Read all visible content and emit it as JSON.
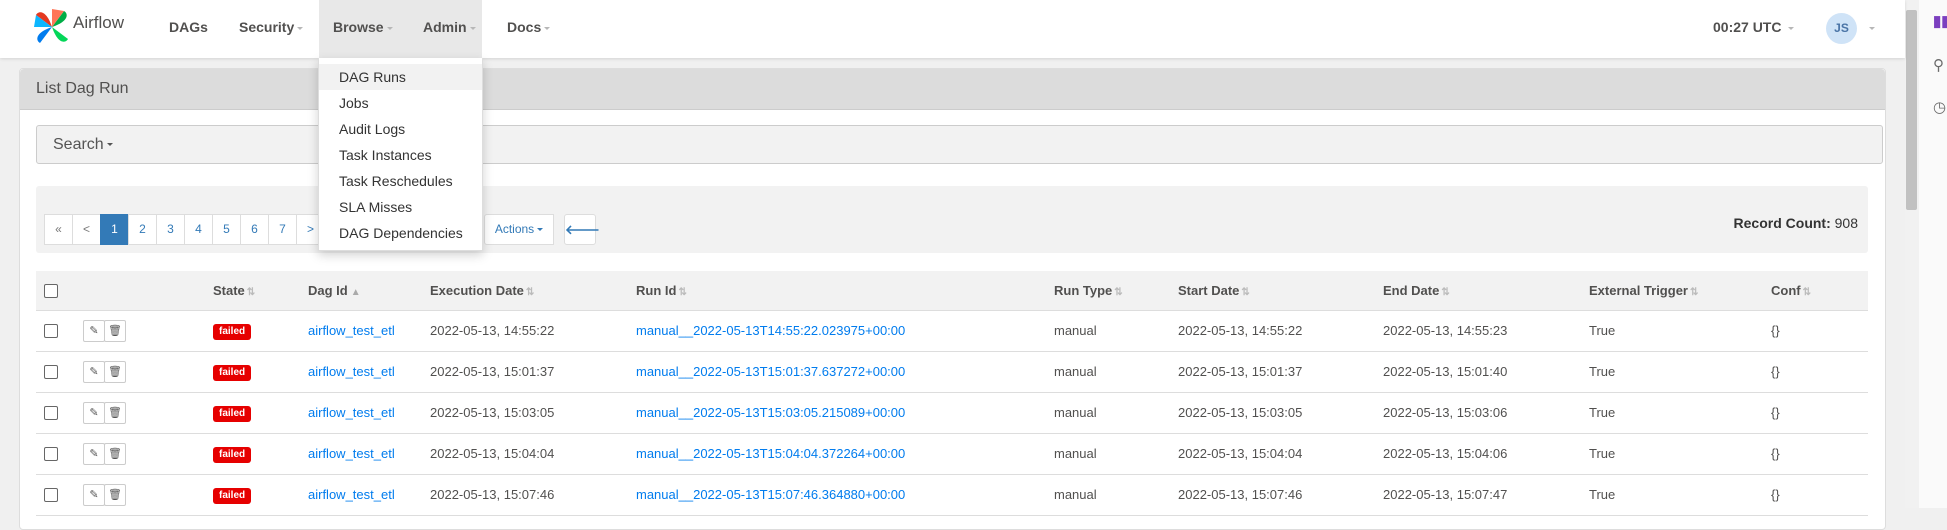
{
  "brand": {
    "name": "Airflow"
  },
  "nav": {
    "dags": "DAGs",
    "security": "Security",
    "browse": "Browse",
    "admin": "Admin",
    "docs": "Docs",
    "clock": "00:27 UTC",
    "avatar_initials": "JS"
  },
  "browse_menu": [
    "DAG Runs",
    "Jobs",
    "Audit Logs",
    "Task Instances",
    "Task Reschedules",
    "SLA Misses",
    "DAG Dependencies"
  ],
  "panel": {
    "title": "List Dag Run",
    "search_label": "Search"
  },
  "pager": {
    "first": "«",
    "prev": "<",
    "pages": [
      "1",
      "2",
      "3",
      "4",
      "5",
      "6",
      "7"
    ],
    "next": ">",
    "active_page": "1"
  },
  "toolbar": {
    "actions_label": "Actions",
    "record_count_label": "Record Count:",
    "record_count_value": "908"
  },
  "table": {
    "columns": {
      "state": "State",
      "dag_id": "Dag Id",
      "execution_date": "Execution Date",
      "run_id": "Run Id",
      "run_type": "Run Type",
      "start_date": "Start Date",
      "end_date": "End Date",
      "external_trigger": "External Trigger",
      "conf": "Conf"
    },
    "rows": [
      {
        "state": "failed",
        "dag_id": "airflow_test_etl",
        "execution_date": "2022-05-13, 14:55:22",
        "run_id": "manual__2022-05-13T14:55:22.023975+00:00",
        "run_type": "manual",
        "start_date": "2022-05-13, 14:55:22",
        "end_date": "2022-05-13, 14:55:23",
        "external_trigger": "True",
        "conf": "{}"
      },
      {
        "state": "failed",
        "dag_id": "airflow_test_etl",
        "execution_date": "2022-05-13, 15:01:37",
        "run_id": "manual__2022-05-13T15:01:37.637272+00:00",
        "run_type": "manual",
        "start_date": "2022-05-13, 15:01:37",
        "end_date": "2022-05-13, 15:01:40",
        "external_trigger": "True",
        "conf": "{}"
      },
      {
        "state": "failed",
        "dag_id": "airflow_test_etl",
        "execution_date": "2022-05-13, 15:03:05",
        "run_id": "manual__2022-05-13T15:03:05.215089+00:00",
        "run_type": "manual",
        "start_date": "2022-05-13, 15:03:05",
        "end_date": "2022-05-13, 15:03:06",
        "external_trigger": "True",
        "conf": "{}"
      },
      {
        "state": "failed",
        "dag_id": "airflow_test_etl",
        "execution_date": "2022-05-13, 15:04:04",
        "run_id": "manual__2022-05-13T15:04:04.372264+00:00",
        "run_type": "manual",
        "start_date": "2022-05-13, 15:04:04",
        "end_date": "2022-05-13, 15:04:06",
        "external_trigger": "True",
        "conf": "{}"
      },
      {
        "state": "failed",
        "dag_id": "airflow_test_etl",
        "execution_date": "2022-05-13, 15:07:46",
        "run_id": "manual__2022-05-13T15:07:46.364880+00:00",
        "run_type": "manual",
        "start_date": "2022-05-13, 15:07:46",
        "end_date": "2022-05-13, 15:07:47",
        "external_trigger": "True",
        "conf": "{}"
      }
    ]
  },
  "colors": {
    "failed_badge": "#e60000",
    "link": "#017cee",
    "active_page": "#337ab7"
  }
}
